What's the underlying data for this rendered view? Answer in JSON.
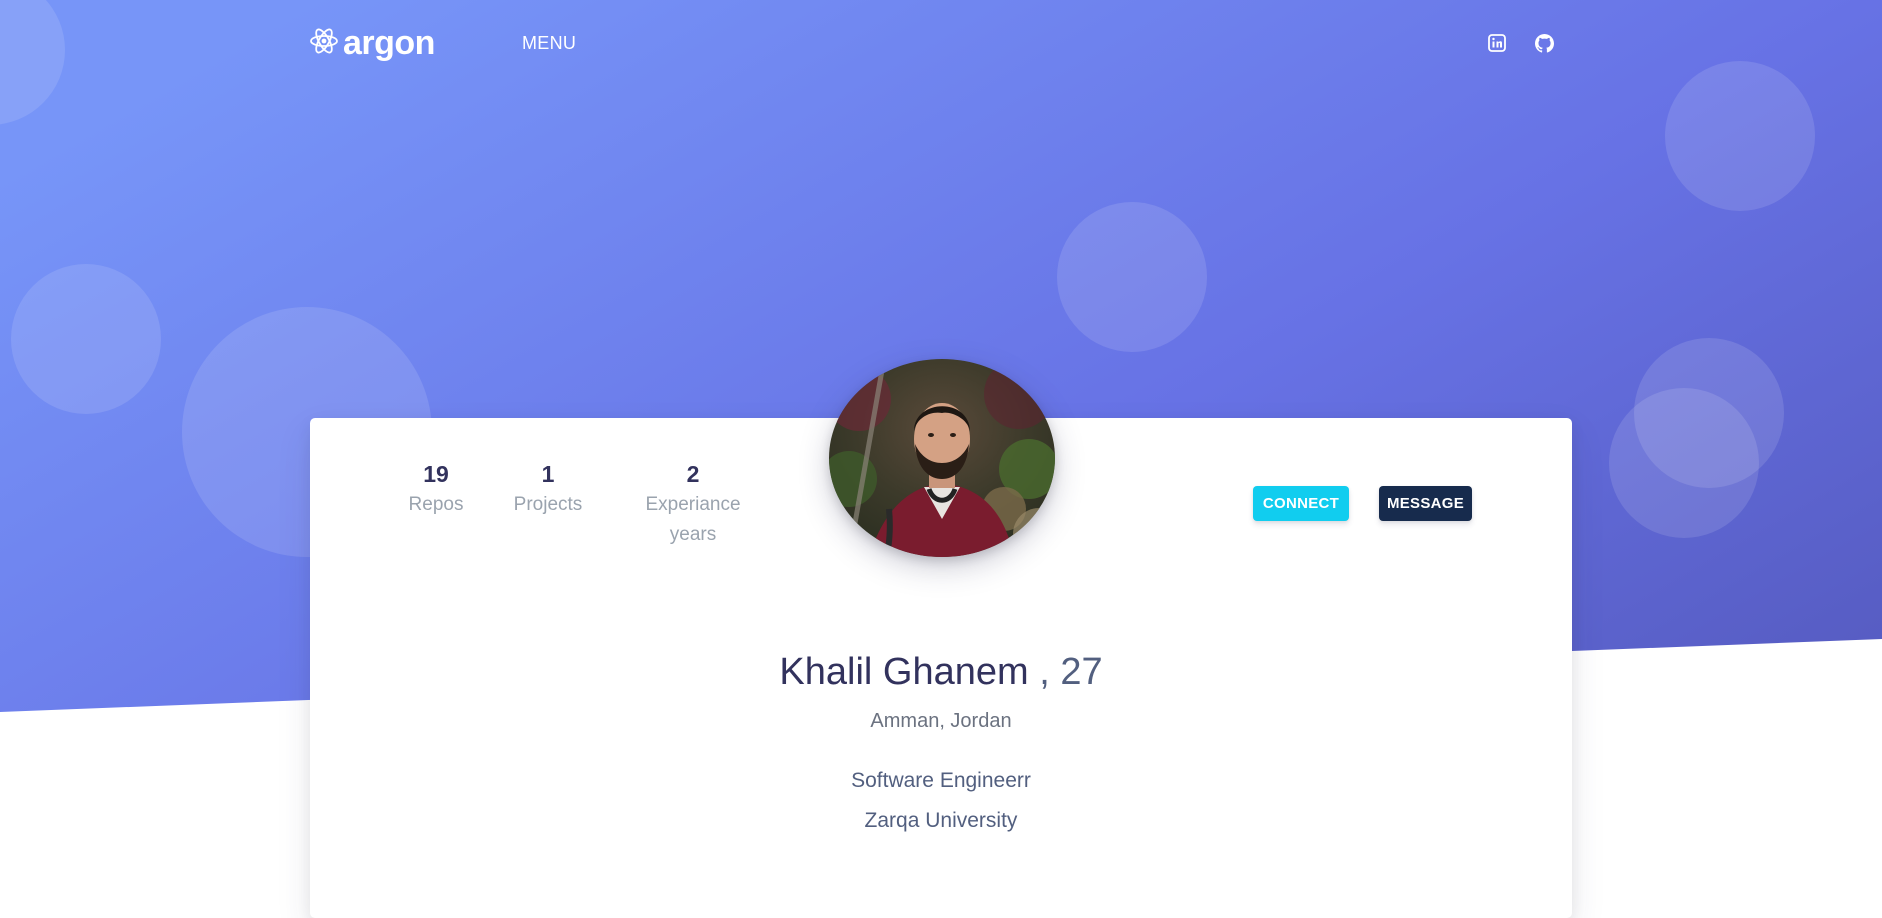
{
  "colors": {
    "hero_start": "#7795f8",
    "hero_end": "#555abf",
    "connect_button": "#11cdef",
    "message_button": "#172b4d",
    "heading": "#32325d",
    "muted": "#9aa3ae"
  },
  "navbar": {
    "brand": "argon",
    "brand_icon": "atom-icon",
    "menu_label": "MENU",
    "social": [
      {
        "icon": "linkedin-icon"
      },
      {
        "icon": "github-icon"
      }
    ]
  },
  "profile": {
    "stats": [
      {
        "value": "19",
        "label": "Repos"
      },
      {
        "value": "1",
        "label": "Projects"
      },
      {
        "value": "2",
        "label_line1": "Experiance",
        "label_line2": "years"
      }
    ],
    "avatar_icon": "profile-photo",
    "connect_label": "CONNECT",
    "message_label": "MESSAGE",
    "name": "Khalil Ghanem",
    "age": ", 27",
    "location": "Amman, Jordan",
    "job_title": "Software Engineerr",
    "education": "Zarqa University"
  }
}
